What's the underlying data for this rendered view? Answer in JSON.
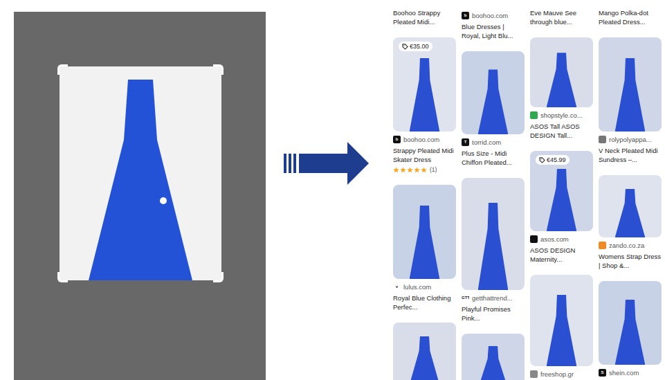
{
  "results": {
    "columns": [
      [
        {
          "title": "Boohoo Strappy Pleated Midi..."
        },
        {
          "price": "€35.00",
          "source": "boohoo.com",
          "logo": "b",
          "color": "#111111",
          "title": "Strappy Pleated Midi Skater Dress",
          "stars": 5,
          "rating_count": "(1)"
        },
        {
          "source": "lulus.com",
          "logo": "v",
          "color": "#ffffff",
          "title": "Royal Blue Clothing Perfec..."
        },
        {}
      ],
      [
        {
          "source": "boohoo.com",
          "logo": "b",
          "color": "#111111",
          "title": "Blue Dresses | Royal, Light Blu..."
        },
        {
          "source": "torrid.com",
          "logo": "T",
          "color": "#111111",
          "title": "Plus Size - Midi Chiffon Pleated..."
        },
        {
          "source": "getthattrend...",
          "logo": "GTT",
          "color": "#ffffff",
          "title": "Playful Promises Pink..."
        },
        {}
      ],
      [
        {
          "title": "Eve Mauve See through blue..."
        },
        {
          "source": "shopstyle.co...",
          "logo": "",
          "color": "#2fa84f",
          "title": "ASOS Tall ASOS DESIGN Tall..."
        },
        {
          "price": "€45.99",
          "source": "asos.com",
          "logo": "",
          "color": "#111111",
          "title": "ASOS DESIGN Maternity..."
        },
        {
          "source": "freeshop.gr",
          "logo": "",
          "color": "#888888"
        }
      ],
      [
        {
          "title": "Mango Polka-dot Pleated Dress..."
        },
        {
          "source": "rolypolyappa...",
          "logo": "",
          "color": "#777777",
          "title": "V Neck Pleated Midi Sundress –..."
        },
        {
          "source": "zando.co.za",
          "logo": "",
          "color": "#f08a24",
          "title": "Womens Strap Dress | Shop &..."
        },
        {
          "source": "shein.com",
          "logo": "S",
          "color": "#111111"
        }
      ]
    ]
  }
}
